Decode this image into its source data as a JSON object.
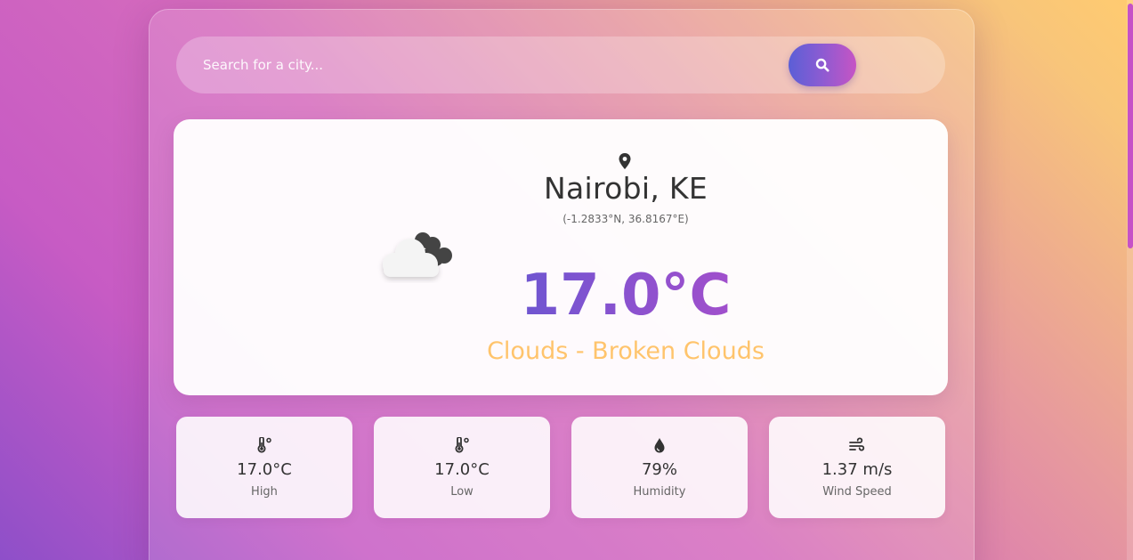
{
  "search": {
    "placeholder": "Search for a city...",
    "button_icon": "search-icon"
  },
  "current": {
    "location_icon": "map-pin-icon",
    "city": "Nairobi, KE",
    "coordinates": "(-1.2833°N, 36.8167°E)",
    "weather_icon": "broken-clouds-icon",
    "temperature": "17.0°C",
    "description": "Clouds - Broken Clouds"
  },
  "stats": [
    {
      "icon": "thermometer-icon",
      "value": "17.0°C",
      "label": "High"
    },
    {
      "icon": "thermometer-icon",
      "value": "17.0°C",
      "label": "Low"
    },
    {
      "icon": "water-drop-icon",
      "value": "79%",
      "label": "Humidity"
    },
    {
      "icon": "wind-icon",
      "value": "1.37 m/s",
      "label": "Wind Speed"
    }
  ],
  "colors": {
    "accent_gradient_start": "#5b5fd6",
    "accent_gradient_end": "#c654c4",
    "description": "#ffc46c",
    "text_primary": "#333333",
    "text_secondary": "#666666"
  }
}
